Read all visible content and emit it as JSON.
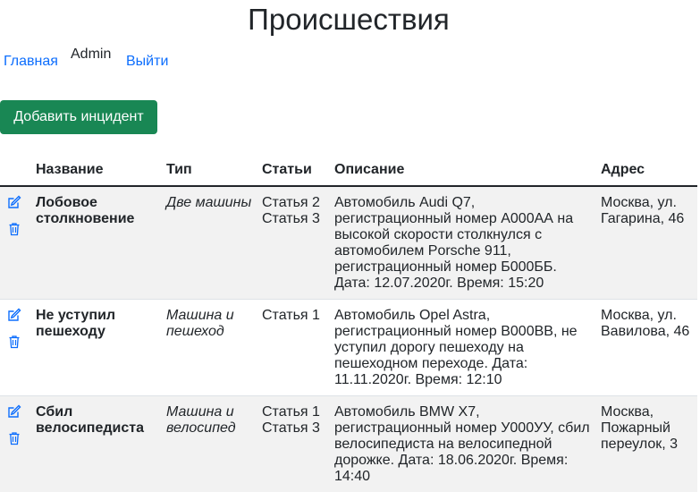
{
  "page": {
    "title": "Происшествия"
  },
  "nav": {
    "home": "Главная",
    "user": "Admin",
    "logout": "Выйти"
  },
  "actions": {
    "add_label": "Добавить инцидент"
  },
  "table": {
    "headers": {
      "name": "Название",
      "type": "Тип",
      "articles": "Статьи",
      "description": "Описание",
      "address": "Адрес"
    },
    "rows": [
      {
        "name": "Лобовое столкновение",
        "type": "Две машины",
        "articles": [
          "Статья 2",
          "Статья 3"
        ],
        "description": "Автомобиль Audi Q7, регистрационный номер А000АА на высокой скорости столкнулся с автомобилем Porsche 911, регистрационный номер Б000ББ. Дата: 12.07.2020г. Время: 15:20",
        "address": "Москва, ул. Гагарина, 46"
      },
      {
        "name": "Не уступил пешеходу",
        "type": "Машина и пешеход",
        "articles": [
          "Статья 1"
        ],
        "description": "Автомобиль Opel Astra, регистрационный номер В000ВВ, не уступил дорогу пешеходу на пешеходном переходе. Дата: 11.11.2020г. Время: 12:10",
        "address": "Москва, ул. Вавилова, 46"
      },
      {
        "name": "Сбил велосипедиста",
        "type": "Машина и велосипед",
        "articles": [
          "Статья 1",
          "Статья 3"
        ],
        "description": "Автомобиль BMW X7, регистрационный номер У000УУ, сбил велосипедиста на велосипедной дорожке. Дата: 18.06.2020г. Время: 14:40",
        "address": "Москва, Пожарный переулок, 3"
      }
    ]
  },
  "colors": {
    "link": "#0d6efd",
    "button_bg": "#198754",
    "stripe": "#f2f2f2"
  },
  "icons": {
    "edit": "edit-icon",
    "delete": "trash-icon"
  }
}
